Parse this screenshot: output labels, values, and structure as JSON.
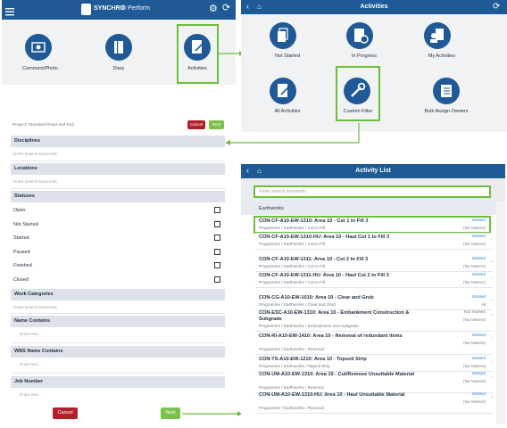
{
  "panel1": {
    "app_name": "SYNCHRO",
    "app_suffix": "® Perform",
    "tiles": [
      {
        "label": "Comment/Photo",
        "icon": "photo-icon"
      },
      {
        "label": "Diary",
        "icon": "book-icon"
      },
      {
        "label": "Activities",
        "icon": "clipboard-pencil-icon"
      }
    ]
  },
  "panel2": {
    "title": "Activities",
    "tiles": [
      {
        "label": "Not Started",
        "icon": "copy-documents-icon"
      },
      {
        "label": "In Progress",
        "icon": "clipboard-gear-icon"
      },
      {
        "label": "My Activities",
        "icon": "user-clipboard-icon"
      },
      {
        "label": "All Activities",
        "icon": "clipboard-pencil-icon"
      },
      {
        "label": "Custom Filter",
        "icon": "wrench-icon"
      },
      {
        "label": "Bulk Assign Owners",
        "icon": "assign-list-icon"
      }
    ]
  },
  "panel3": {
    "project": "Project: Standard Road and Rail",
    "cancel_label": "Cancel",
    "next_label": "Next",
    "disciplines_label": "Disciplines",
    "locations_label": "Locations",
    "statuses_label": "Statuses",
    "work_categories_label": "Work Categories",
    "name_contains_label": "Name Contains",
    "wbs_name_contains_label": "WBS Name Contains",
    "job_number_label": "Job Number",
    "search_placeholder": "Enter search keywords",
    "text_placeholder": "Enter text...",
    "statuses": [
      "Open",
      "Not Started",
      "Started",
      "Paused",
      "Finished",
      "Closed"
    ],
    "bottom_cancel": "Cancel",
    "bottom_next": "Next"
  },
  "panel4": {
    "title": "Activity List",
    "search_placeholder": "Enter search keywords",
    "group": "Earthworks",
    "items": [
      {
        "title": "CON-CF-A10-EW-1310: Area 10 - Cut 1 to Fill 3",
        "path": "Programme / Earthworks / Cut to Fill",
        "status": "Started",
        "owner": "(No Owners)"
      },
      {
        "title": "CON-CF-A10-EW-1310-HU: Area 10 - Haul Cut 1 to Fill 3",
        "path": "Programme / Earthworks / Cut to Fill",
        "status": "Started",
        "owner": "(No Owners)"
      },
      {
        "title": "CON-CF-A10-EW-1311: Area 10 - Cut 2 to Fill 3",
        "path": "Programme / Earthworks / Cut to Fill",
        "status": "Started",
        "owner": "(No Owners)"
      },
      {
        "title": "CON-CF-A10-EW-1311-HU: Area 10 - Haul Cut 2 to Fill 3",
        "path": "Programme / Earthworks / Cut to Fill",
        "status": "Started",
        "owner": "(No Owners)"
      },
      {
        "title": "CON-CG-A10-EW-1010: Area 10 - Clear and Grub",
        "path": "Programme / Earthworks / Clear and Grub",
        "status": "Started",
        "owner": "All"
      },
      {
        "title": "CON-ESC-A10-EW-1310: Area 10 - Embankment Construction & Subgrade",
        "path": "Programme / Earthworks / Embankment and Subgrade",
        "status": "Not Started",
        "owner": "(No Owners)"
      },
      {
        "title": "CON-RI-A10-EW-1410: Area 10 - Removal of redundant items",
        "path": "Programme / Earthworks / Removal",
        "status": "Started",
        "owner": "(No Owners)"
      },
      {
        "title": "CON-TS-A10-EW-1210: Area 10 - Topsoil Strip",
        "path": "Programme / Earthworks / Topsoil Strip",
        "status": "Started",
        "owner": "(No Owners)"
      },
      {
        "title": "CON-UM-A10-EW-1310: Area 10 - Cut/Remove Unsuitable Material",
        "path": "Programme / Earthworks / Removal",
        "status": "Started",
        "owner": "(No Owners)"
      },
      {
        "title": "CON-UM-A10-EW-1310-HU: Area 10 - Haul Unsuitable Material",
        "path": "Programme / Earthworks / Removal",
        "status": "Started",
        "owner": "(No Owners)"
      }
    ]
  }
}
